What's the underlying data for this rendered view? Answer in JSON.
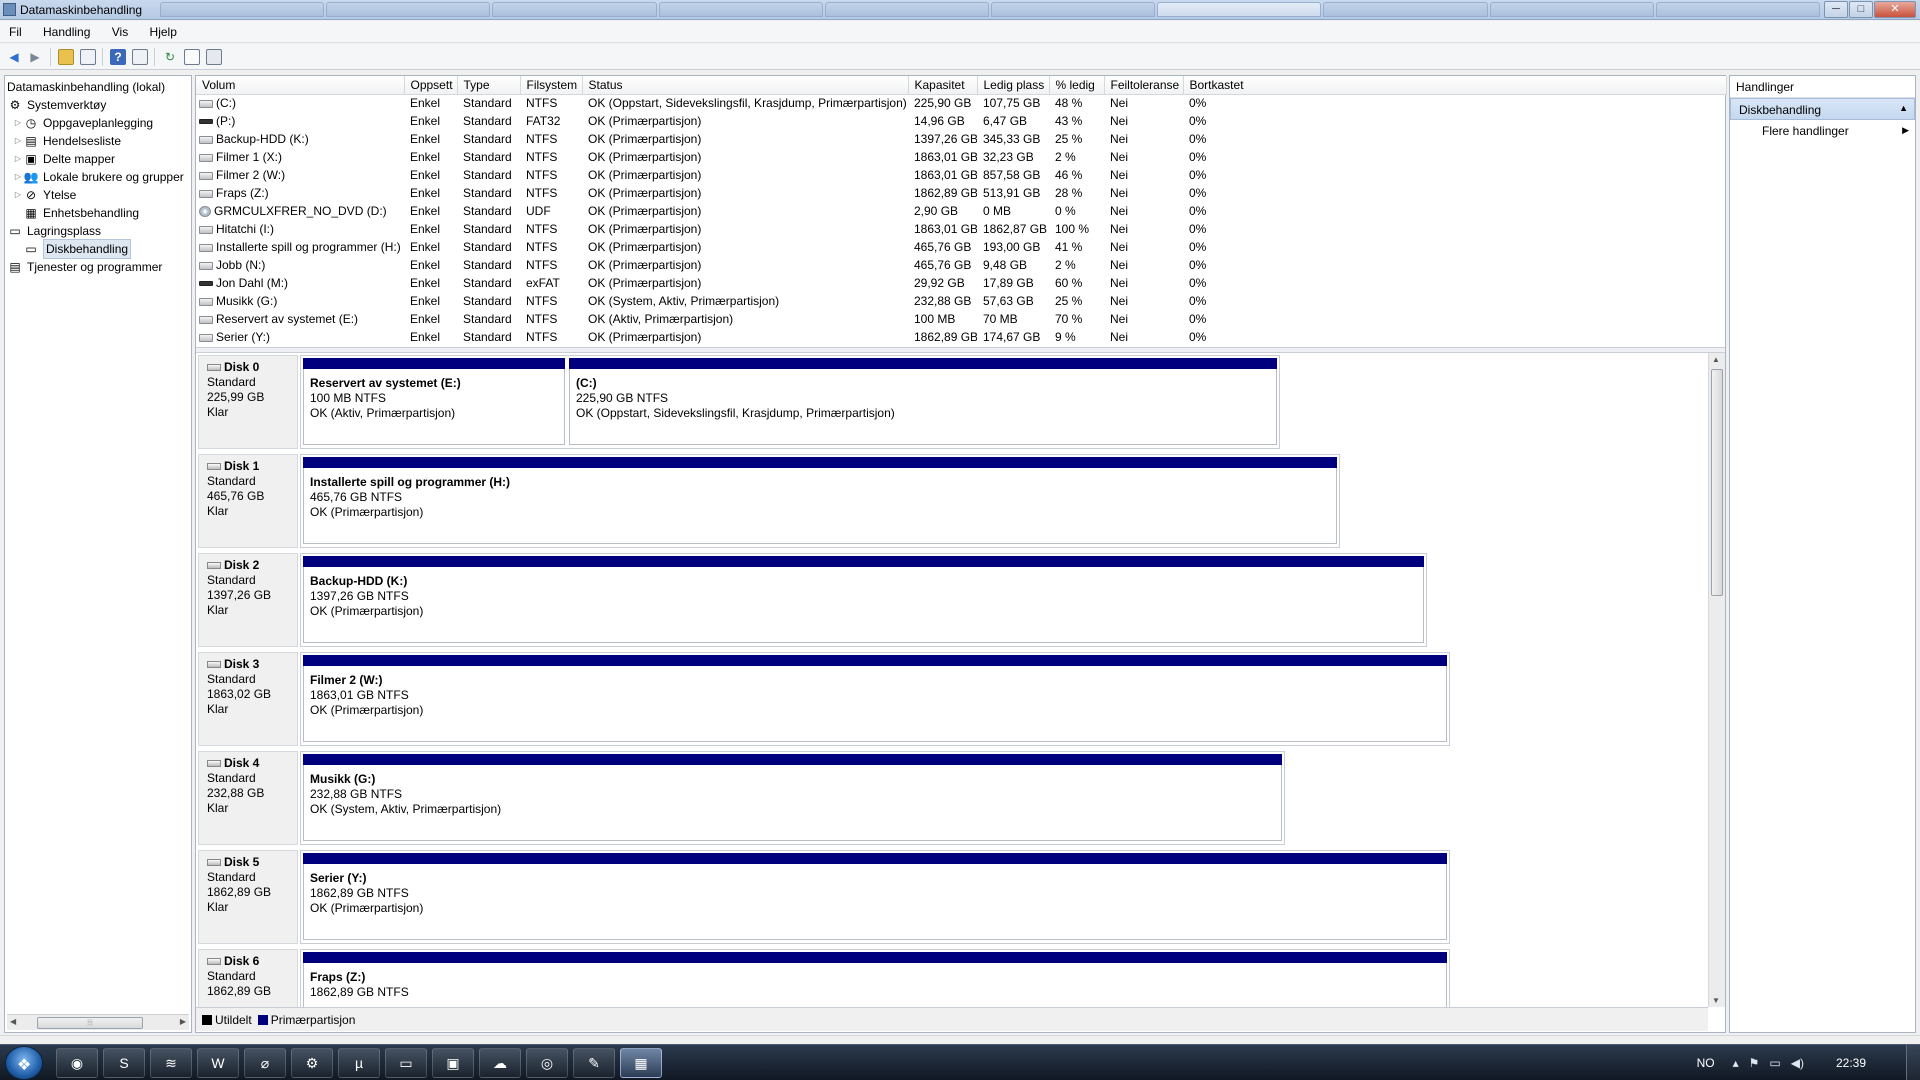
{
  "window": {
    "title": "Datamaskinbehandling",
    "minimize": "─",
    "maximize": "□",
    "close": "✕"
  },
  "menu": [
    "Fil",
    "Handling",
    "Vis",
    "Hjelp"
  ],
  "tree": [
    {
      "label": "Datamaskinbehandling (lokal)",
      "level": 0,
      "icon": "computer-icon",
      "glyph": "🖥"
    },
    {
      "label": "Systemverktøy",
      "level": 1,
      "icon": "tools-icon",
      "glyph": "⚙"
    },
    {
      "label": "Oppgaveplanlegging",
      "level": 2,
      "icon": "clock-icon",
      "glyph": "◷",
      "expandable": true
    },
    {
      "label": "Hendelsesliste",
      "level": 2,
      "icon": "event-log-icon",
      "glyph": "▤",
      "expandable": true
    },
    {
      "label": "Delte mapper",
      "level": 2,
      "icon": "shared-folder-icon",
      "glyph": "▣",
      "expandable": true
    },
    {
      "label": "Lokale brukere og grupper",
      "level": 2,
      "icon": "users-icon",
      "glyph": "👥",
      "expandable": true
    },
    {
      "label": "Ytelse",
      "level": 2,
      "icon": "performance-icon",
      "glyph": "⊘",
      "expandable": true
    },
    {
      "label": "Enhetsbehandling",
      "level": 2,
      "icon": "device-manager-icon",
      "glyph": "▦"
    },
    {
      "label": "Lagringsplass",
      "level": 1,
      "icon": "storage-icon",
      "glyph": "▭"
    },
    {
      "label": "Diskbehandling",
      "level": 2,
      "icon": "disk-management-icon",
      "glyph": "▭",
      "selected": true
    },
    {
      "label": "Tjenester og programmer",
      "level": 1,
      "icon": "services-icon",
      "glyph": "▤"
    }
  ],
  "volume_table": {
    "columns": [
      "Volum",
      "Oppsett",
      "Type",
      "Filsystem",
      "Status",
      "Kapasitet",
      "Ledig plass",
      "% ledig",
      "Feiltoleranse",
      "Bortkastet"
    ],
    "rows": [
      [
        "(C:)",
        "Enkel",
        "Standard",
        "NTFS",
        "OK (Oppstart, Sidevekslingsfil, Krasjdump, Primærpartisjon)",
        "225,90 GB",
        "107,75 GB",
        "48 %",
        "Nei",
        "0%"
      ],
      [
        "(P:)",
        "Enkel",
        "Standard",
        "FAT32",
        "OK (Primærpartisjon)",
        "14,96 GB",
        "6,47 GB",
        "43 %",
        "Nei",
        "0%"
      ],
      [
        "Backup-HDD (K:)",
        "Enkel",
        "Standard",
        "NTFS",
        "OK (Primærpartisjon)",
        "1397,26 GB",
        "345,33 GB",
        "25 %",
        "Nei",
        "0%"
      ],
      [
        "Filmer 1 (X:)",
        "Enkel",
        "Standard",
        "NTFS",
        "OK (Primærpartisjon)",
        "1863,01 GB",
        "32,23 GB",
        "2 %",
        "Nei",
        "0%"
      ],
      [
        "Filmer 2 (W:)",
        "Enkel",
        "Standard",
        "NTFS",
        "OK (Primærpartisjon)",
        "1863,01 GB",
        "857,58 GB",
        "46 %",
        "Nei",
        "0%"
      ],
      [
        "Fraps (Z:)",
        "Enkel",
        "Standard",
        "NTFS",
        "OK (Primærpartisjon)",
        "1862,89 GB",
        "513,91 GB",
        "28 %",
        "Nei",
        "0%"
      ],
      [
        "GRMCULXFRER_NO_DVD (D:)",
        "Enkel",
        "Standard",
        "UDF",
        "OK (Primærpartisjon)",
        "2,90 GB",
        "0 MB",
        "0 %",
        "Nei",
        "0%"
      ],
      [
        "Hitatchi (I:)",
        "Enkel",
        "Standard",
        "NTFS",
        "OK (Primærpartisjon)",
        "1863,01 GB",
        "1862,87 GB",
        "100 %",
        "Nei",
        "0%"
      ],
      [
        "Installerte spill og programmer (H:)",
        "Enkel",
        "Standard",
        "NTFS",
        "OK (Primærpartisjon)",
        "465,76 GB",
        "193,00 GB",
        "41 %",
        "Nei",
        "0%"
      ],
      [
        "Jobb (N:)",
        "Enkel",
        "Standard",
        "NTFS",
        "OK (Primærpartisjon)",
        "465,76 GB",
        "9,48 GB",
        "2 %",
        "Nei",
        "0%"
      ],
      [
        "Jon Dahl (M:)",
        "Enkel",
        "Standard",
        "exFAT",
        "OK (Primærpartisjon)",
        "29,92 GB",
        "17,89 GB",
        "60 %",
        "Nei",
        "0%"
      ],
      [
        "Musikk (G:)",
        "Enkel",
        "Standard",
        "NTFS",
        "OK (System, Aktiv, Primærpartisjon)",
        "232,88 GB",
        "57,63 GB",
        "25 %",
        "Nei",
        "0%"
      ],
      [
        "Reservert av systemet (E:)",
        "Enkel",
        "Standard",
        "NTFS",
        "OK (Aktiv, Primærpartisjon)",
        "100 MB",
        "70 MB",
        "70 %",
        "Nei",
        "0%"
      ],
      [
        "Serier (Y:)",
        "Enkel",
        "Standard",
        "NTFS",
        "OK (Primærpartisjon)",
        "1862,89 GB",
        "174,67 GB",
        "9 %",
        "Nei",
        "0%"
      ]
    ],
    "row_icons": [
      "hdd-icon",
      "usb-drive-icon",
      "hdd-icon",
      "hdd-icon",
      "hdd-icon",
      "hdd-icon",
      "cd-icon",
      "hdd-icon",
      "hdd-icon",
      "hdd-icon",
      "usb-drive-icon",
      "hdd-icon",
      "hdd-icon",
      "hdd-icon"
    ]
  },
  "disks": [
    {
      "name": "Disk 0",
      "type": "Standard",
      "size": "225,99 GB",
      "state": "Klar",
      "partitions": [
        {
          "name": "Reservert av systemet  (E:)",
          "size": "100 MB NTFS",
          "status": "OK (Aktiv, Primærpartisjon)"
        },
        {
          "name": "(C:)",
          "size": "225,90 GB NTFS",
          "status": "OK (Oppstart, Sidevekslingsfil, Krasjdump, Primærpartisjon)"
        }
      ]
    },
    {
      "name": "Disk 1",
      "type": "Standard",
      "size": "465,76 GB",
      "state": "Klar",
      "partitions": [
        {
          "name": "Installerte spill og programmer  (H:)",
          "size": "465,76 GB NTFS",
          "status": "OK (Primærpartisjon)"
        }
      ]
    },
    {
      "name": "Disk 2",
      "type": "Standard",
      "size": "1397,26 GB",
      "state": "Klar",
      "partitions": [
        {
          "name": "Backup-HDD  (K:)",
          "size": "1397,26 GB NTFS",
          "status": "OK (Primærpartisjon)"
        }
      ]
    },
    {
      "name": "Disk 3",
      "type": "Standard",
      "size": "1863,02 GB",
      "state": "Klar",
      "partitions": [
        {
          "name": "Filmer 2  (W:)",
          "size": "1863,01 GB NTFS",
          "status": "OK (Primærpartisjon)"
        }
      ]
    },
    {
      "name": "Disk 4",
      "type": "Standard",
      "size": "232,88 GB",
      "state": "Klar",
      "partitions": [
        {
          "name": "Musikk  (G:)",
          "size": "232,88 GB NTFS",
          "status": "OK (System, Aktiv, Primærpartisjon)"
        }
      ]
    },
    {
      "name": "Disk 5",
      "type": "Standard",
      "size": "1862,89 GB",
      "state": "Klar",
      "partitions": [
        {
          "name": "Serier  (Y:)",
          "size": "1862,89 GB NTFS",
          "status": "OK (Primærpartisjon)"
        }
      ]
    },
    {
      "name": "Disk 6",
      "type": "Standard",
      "size": "1862,89 GB",
      "state": "",
      "partitions": [
        {
          "name": "Fraps  (Z:)",
          "size": "1862,89 GB NTFS",
          "status": ""
        }
      ]
    }
  ],
  "legend": [
    {
      "label": "Utildelt",
      "color": "#000000"
    },
    {
      "label": "Primærpartisjon",
      "color": "#00007f"
    }
  ],
  "actions": {
    "header": "Handlinger",
    "section": "Diskbehandling",
    "more": "Flere handlinger"
  },
  "taskbar": {
    "apps": [
      "chrome-icon",
      "skype-icon",
      "spotify-icon",
      "word-icon",
      "photoshop-icon",
      "steam-icon",
      "utorrent-icon",
      "explorer-icon",
      "task-icon",
      "network-icon",
      "media-icon",
      "acrobat-icon",
      "computer-management-icon"
    ],
    "app_glyphs": [
      "◉",
      "S",
      "≋",
      "W",
      "⌀",
      "⚙",
      "µ",
      "▭",
      "▣",
      "☁",
      "◎",
      "✎",
      "▦"
    ],
    "language": "NO",
    "time": "22:39"
  },
  "colors": {
    "primary_partition": "#00007f",
    "unallocated": "#000000",
    "selection": "#dde6f1"
  }
}
